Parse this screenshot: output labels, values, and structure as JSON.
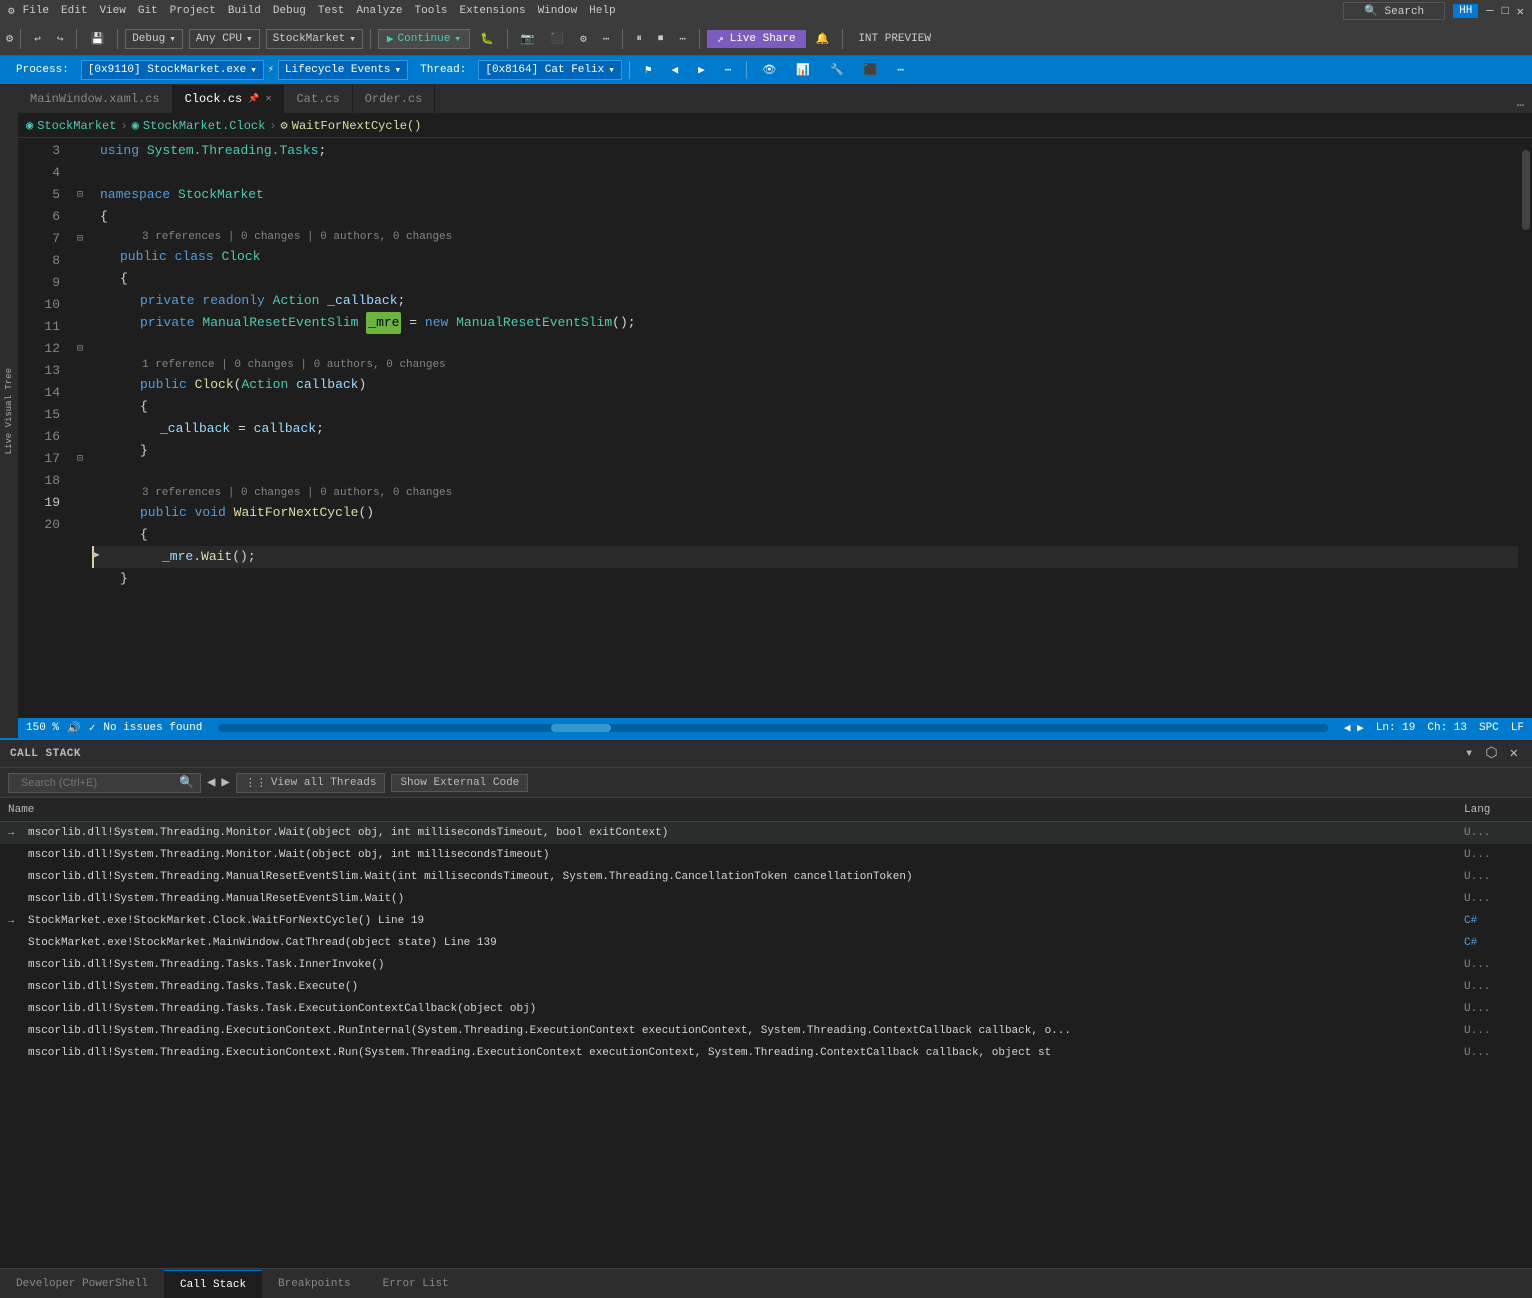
{
  "titlebar": {
    "app_icons": "● ■ ✕",
    "menus": [
      "File",
      "Edit",
      "View",
      "Git",
      "Project",
      "Build",
      "Debug",
      "Test",
      "Analyze",
      "Tools",
      "Extensions",
      "Window",
      "Help"
    ],
    "search_placeholder": "Search",
    "username": "HH",
    "window_controls": [
      "─",
      "□",
      "✕"
    ]
  },
  "toolbar": {
    "undo": "↩",
    "redo": "↪",
    "debug_config": "Debug",
    "platform": "Any CPU",
    "project": "StockMarket",
    "continue_label": "Continue",
    "live_share": "Live Share",
    "int_preview": "INT PREVIEW"
  },
  "debug_bar": {
    "process": "Process:",
    "process_val": "[0x9110] StockMarket.exe",
    "lifecycle": "Lifecycle Events",
    "thread_label": "Thread:",
    "thread_val": "[0x8164] Cat Felix"
  },
  "tabs": [
    {
      "label": "MainWindow.xaml.cs",
      "active": false,
      "modified": false
    },
    {
      "label": "Clock.cs",
      "active": true,
      "modified": false
    },
    {
      "label": "Cat.cs",
      "active": false,
      "modified": false
    },
    {
      "label": "Order.cs",
      "active": false,
      "modified": false
    }
  ],
  "breadcrumb": {
    "project": "StockMarket",
    "class": "StockMarket.Clock",
    "method": "WaitForNextCycle()"
  },
  "code_lines": [
    {
      "num": 3,
      "content": "using System.Threading.Tasks;",
      "type": "using"
    },
    {
      "num": 4,
      "content": "",
      "type": "blank"
    },
    {
      "num": 5,
      "content": "namespace StockMarket",
      "type": "ns"
    },
    {
      "num": 6,
      "content": "{",
      "type": "brace"
    },
    {
      "num": 7,
      "content": "    public class Clock",
      "type": "class",
      "refs": "3 references | 0 changes | 0 authors, 0 changes"
    },
    {
      "num": 8,
      "content": "    {",
      "type": "brace"
    },
    {
      "num": 9,
      "content": "        private readonly Action _callback;",
      "type": "field"
    },
    {
      "num": 10,
      "content": "        private ManualResetEventSlim _mre = new ManualResetEventSlim();",
      "type": "field",
      "highlight": "_mre"
    },
    {
      "num": 11,
      "content": "",
      "type": "blank"
    },
    {
      "num": 12,
      "content": "        public Clock(Action callback)",
      "type": "method",
      "refs": "1 reference | 0 changes | 0 authors, 0 changes"
    },
    {
      "num": 13,
      "content": "        {",
      "type": "brace"
    },
    {
      "num": 14,
      "content": "            _callback = callback;",
      "type": "stmt"
    },
    {
      "num": 15,
      "content": "        }",
      "type": "brace"
    },
    {
      "num": 16,
      "content": "",
      "type": "blank"
    },
    {
      "num": 17,
      "content": "        public void WaitForNextCycle()",
      "type": "method",
      "refs": "3 references | 0 changes | 0 authors, 0 changes"
    },
    {
      "num": 18,
      "content": "        {",
      "type": "brace"
    },
    {
      "num": 19,
      "content": "            _mre.Wait();",
      "type": "current",
      "current": true
    },
    {
      "num": 20,
      "content": "    }",
      "type": "brace"
    }
  ],
  "status_bar": {
    "zoom": "150 %",
    "no_issues": "No issues found",
    "line": "Ln: 19",
    "col": "Ch: 13",
    "encoding": "SPC",
    "line_ending": "LF"
  },
  "call_stack": {
    "title": "Call Stack",
    "search_placeholder": "Search (Ctrl+E)",
    "view_threads_label": "View all Threads",
    "show_external_label": "Show External Code",
    "columns": {
      "name": "Name",
      "lang": "Lang"
    },
    "rows": [
      {
        "current": true,
        "icon": "→",
        "text": "mscorlib.dll!System.Threading.Monitor.Wait(object obj, int millisecondsTimeout, bool exitContext)",
        "lang": "U...",
        "lang_type": "u"
      },
      {
        "current": false,
        "icon": "",
        "text": "mscorlib.dll!System.Threading.Monitor.Wait(object obj, int millisecondsTimeout)",
        "lang": "U...",
        "lang_type": "u"
      },
      {
        "current": false,
        "icon": "",
        "text": "mscorlib.dll!System.Threading.ManualResetEventSlim.Wait(int millisecondsTimeout, System.Threading.CancellationToken cancellationToken)",
        "lang": "U...",
        "lang_type": "u"
      },
      {
        "current": false,
        "icon": "",
        "text": "mscorlib.dll!System.Threading.ManualResetEventSlim.Wait()",
        "lang": "U...",
        "lang_type": "u"
      },
      {
        "current": false,
        "icon": "→",
        "text": "StockMarket.exe!StockMarket.Clock.WaitForNextCycle() Line 19",
        "lang": "C#",
        "lang_type": "cs"
      },
      {
        "current": false,
        "icon": "",
        "text": "StockMarket.exe!StockMarket.MainWindow.CatThread(object state) Line 139",
        "lang": "C#",
        "lang_type": "cs"
      },
      {
        "current": false,
        "icon": "",
        "text": "mscorlib.dll!System.Threading.Tasks.Task.InnerInvoke()",
        "lang": "U...",
        "lang_type": "u"
      },
      {
        "current": false,
        "icon": "",
        "text": "mscorlib.dll!System.Threading.Tasks.Task.Execute()",
        "lang": "U...",
        "lang_type": "u"
      },
      {
        "current": false,
        "icon": "",
        "text": "mscorlib.dll!System.Threading.Tasks.Task.ExecutionContextCallback(object obj)",
        "lang": "U...",
        "lang_type": "u"
      },
      {
        "current": false,
        "icon": "",
        "text": "mscorlib.dll!System.Threading.ExecutionContext.RunInternal(System.Threading.ExecutionContext executionContext, System.Threading.ContextCallback callback, o...",
        "lang": "U...",
        "lang_type": "u"
      },
      {
        "current": false,
        "icon": "",
        "text": "mscorlib.dll!System.Threading.ExecutionContext.Run(System.Threading.ExecutionContext executionContext, System.Threading.ContextCallback callback, object st",
        "lang": "U...",
        "lang_type": "u"
      }
    ]
  },
  "bottom_tabs": [
    {
      "label": "Developer PowerShell",
      "active": false
    },
    {
      "label": "Call Stack",
      "active": true
    },
    {
      "label": "Breakpoints",
      "active": false
    },
    {
      "label": "Error List",
      "active": false
    }
  ]
}
